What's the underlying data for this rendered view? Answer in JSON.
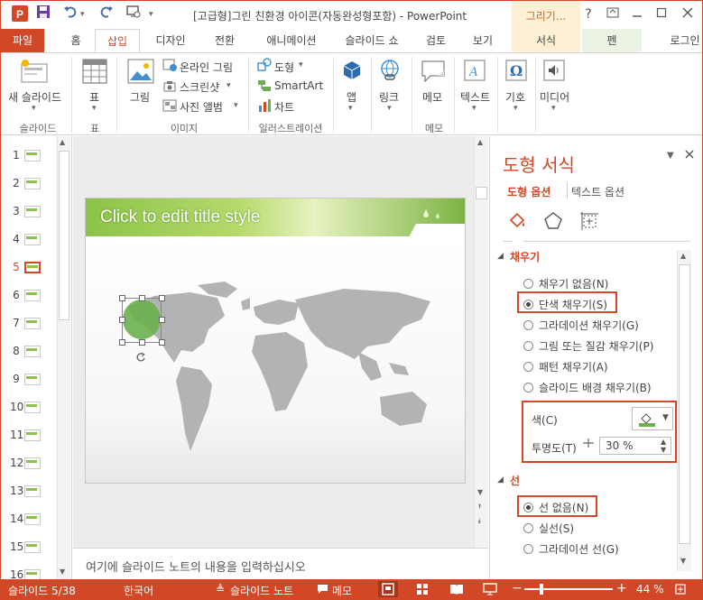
{
  "window": {
    "title": "[고급형]그린 친환경 아이콘(자동완성형포함) - PowerPoint",
    "help_icon": "?",
    "contextual_group": "그리기..."
  },
  "tabs": {
    "file": "파일",
    "home": "홈",
    "insert": "삽입",
    "design": "디자인",
    "transitions": "전환",
    "animations": "애니메이션",
    "slideshow": "슬라이드 쇼",
    "review": "검토",
    "view": "보기",
    "format": "서식",
    "pen": "펜",
    "login": "로그인"
  },
  "ribbon": {
    "new_slide": "새 슬라이드",
    "group_slides": "슬라이드",
    "table": "표",
    "group_table": "표",
    "picture": "그림",
    "online_picture": "온라인 그림",
    "screenshot": "스크린샷",
    "photo_album": "사진 앨범",
    "group_images": "이미지",
    "shapes": "도형",
    "smartart": "SmartArt",
    "chart": "차트",
    "group_illustrations": "일러스트레이션",
    "apps": "앱",
    "link": "링크",
    "memo": "메모",
    "group_memo": "메모",
    "text": "텍스트",
    "symbol": "기호",
    "media": "미디어"
  },
  "thumbnails": [
    "1",
    "2",
    "3",
    "4",
    "5",
    "6",
    "7",
    "8",
    "9",
    "10",
    "11",
    "12",
    "13",
    "14",
    "15",
    "16"
  ],
  "selected_slide": "5",
  "slide": {
    "title_placeholder": "Click to edit title style"
  },
  "notes": {
    "placeholder": "여기에 슬라이드 노트의 내용을 입력하십시오"
  },
  "format_pane": {
    "title": "도형 서식",
    "tab_shape": "도형 옵션",
    "tab_text": "텍스트 옵션",
    "fill_section": "채우기",
    "fill_options": [
      "채우기 없음(N)",
      "단색 채우기(S)",
      "그라데이션 채우기(G)",
      "그림 또는 질감 채우기(P)",
      "패턴 채우기(A)",
      "슬라이드 배경 채우기(B)"
    ],
    "fill_selected": "단색 채우기(S)",
    "color_label": "색(C)",
    "transparency_label": "투명도(T)",
    "transparency_value": "30 %",
    "line_section": "선",
    "line_options": [
      "선 없음(N)",
      "실선(S)",
      "그라데이션 선(G)"
    ],
    "line_selected": "선 없음(N)"
  },
  "statusbar": {
    "slide_info": "슬라이드 5/38",
    "language": "한국어",
    "notes": "슬라이드 노트",
    "comments": "메모",
    "zoom": "44 %"
  },
  "colors": {
    "accent": "#d24726",
    "shape_fill": "#6ab04c"
  }
}
